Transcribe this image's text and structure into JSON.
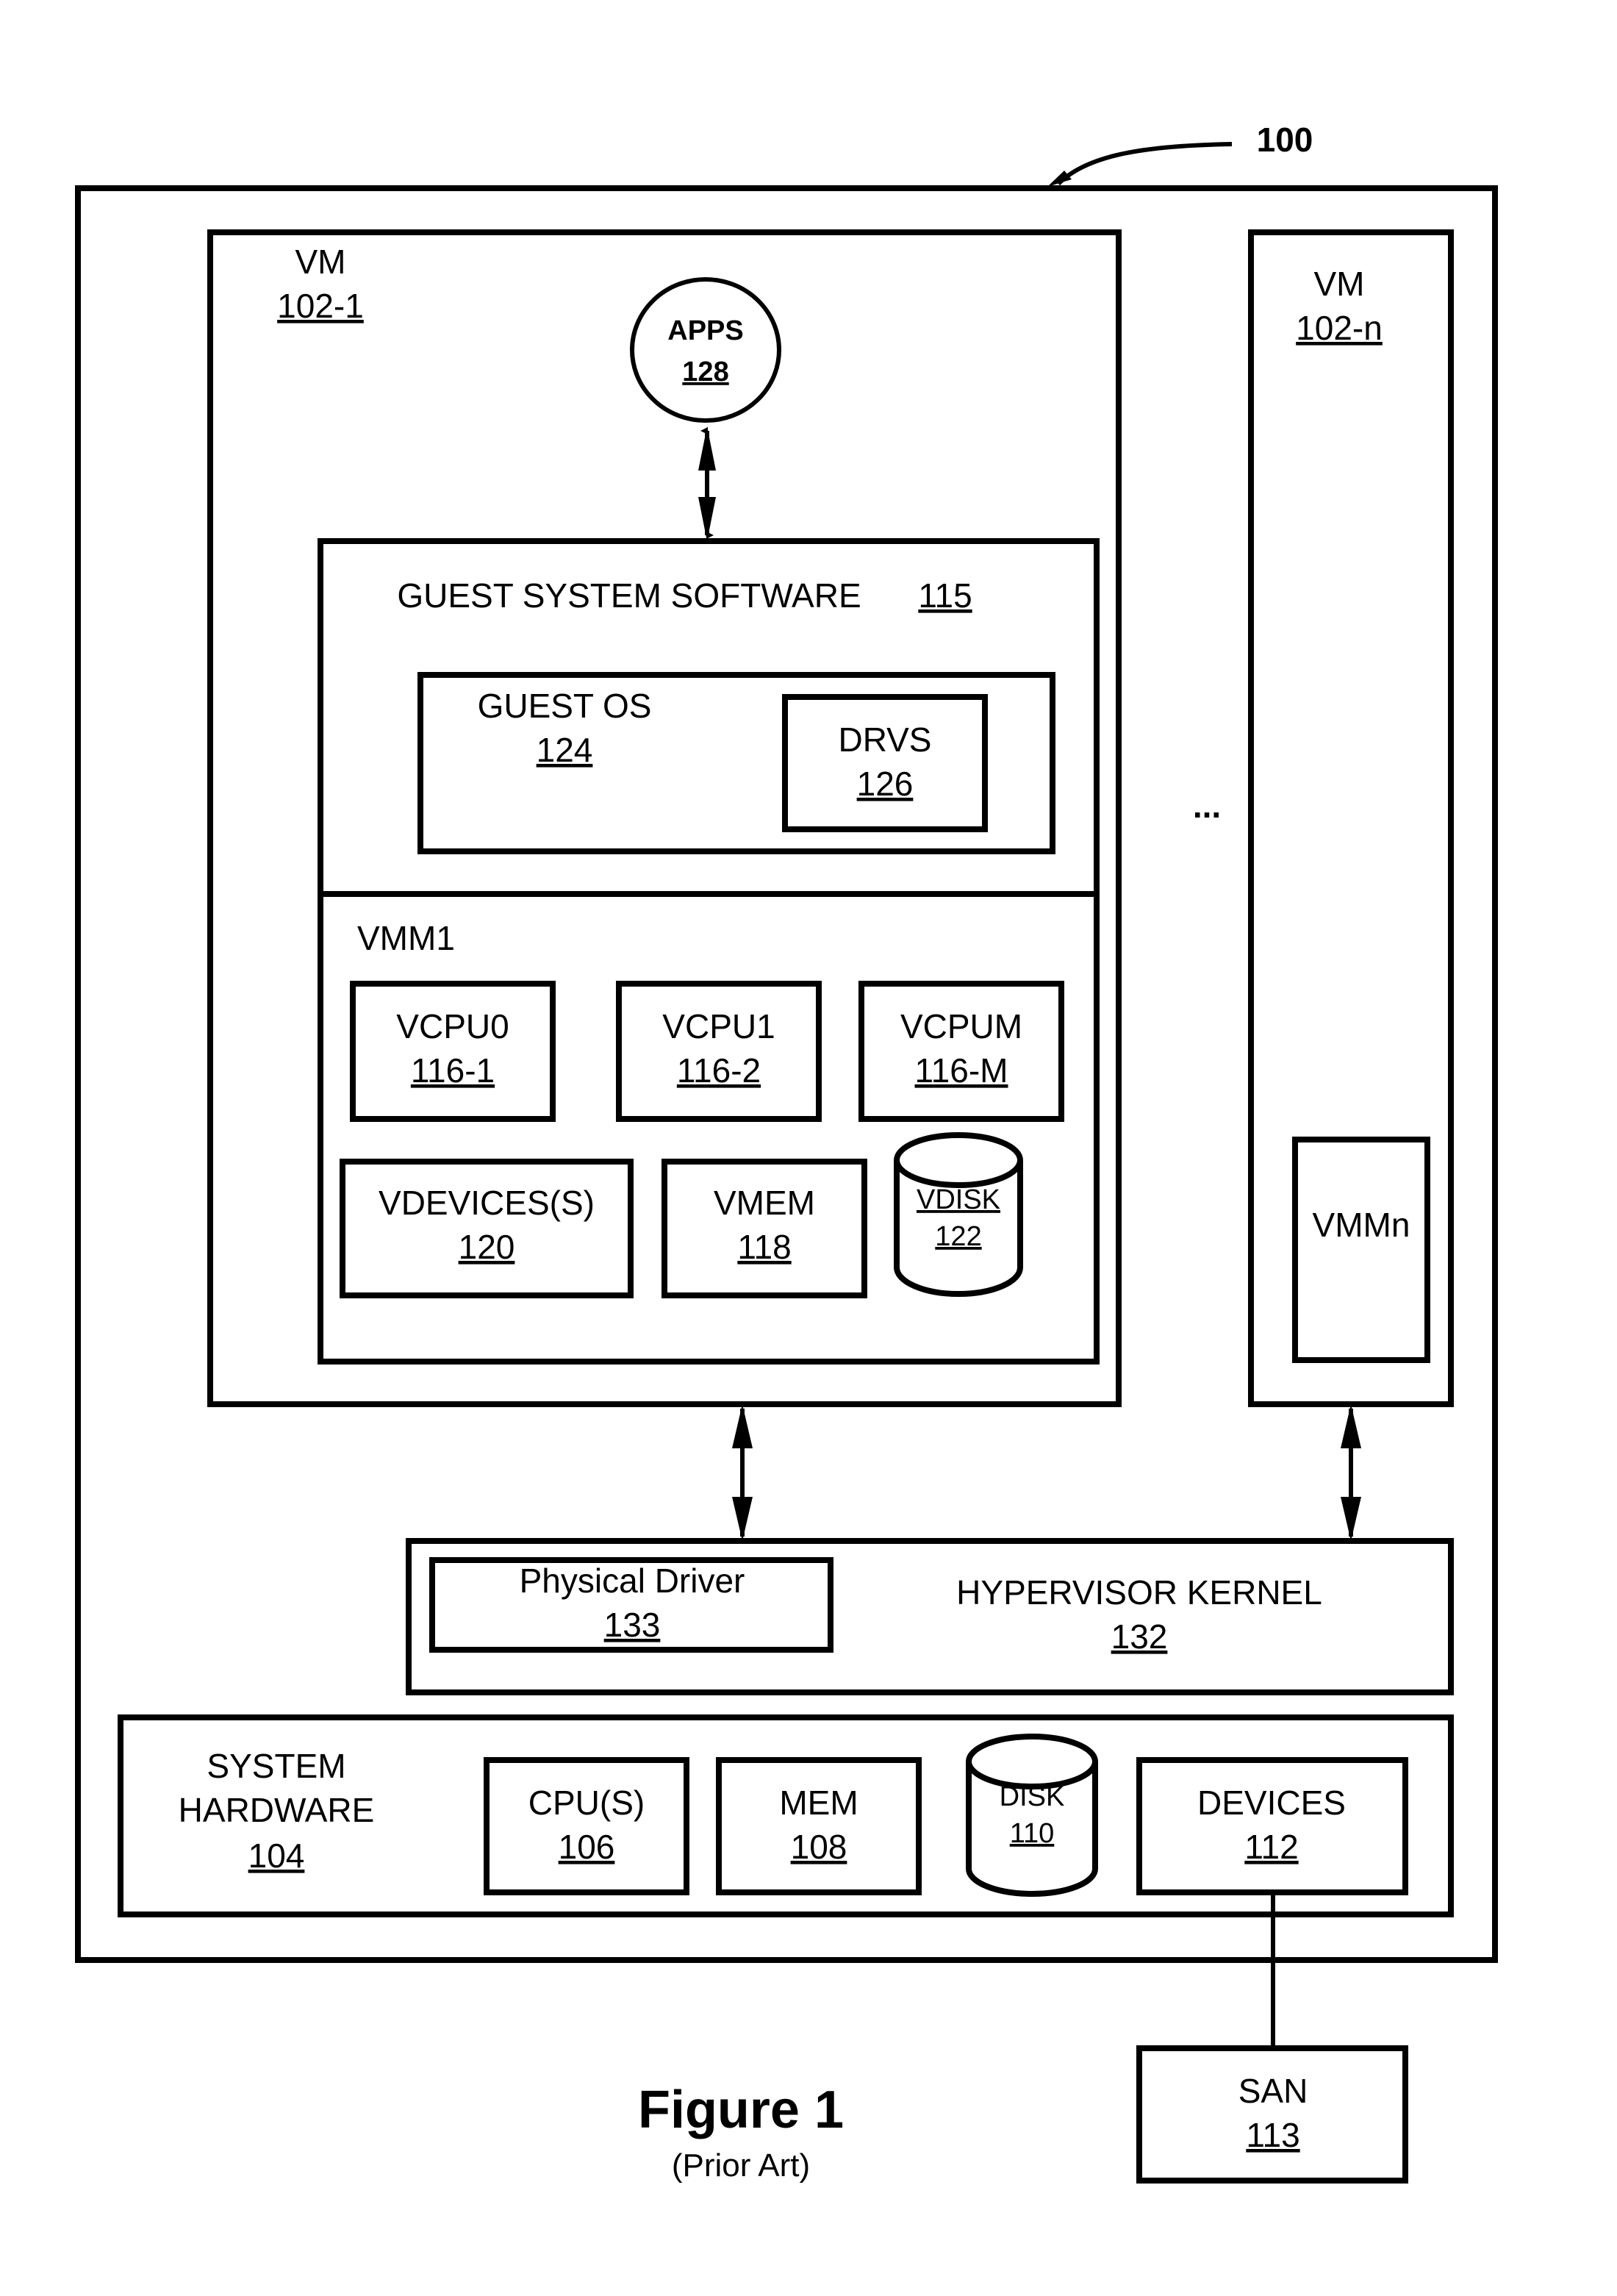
{
  "figure": {
    "ref_label": "100",
    "title": "Figure 1",
    "subtitle": "(Prior Art)"
  },
  "vm1": {
    "label": "VM",
    "ref": "102-1",
    "apps": {
      "label": "APPS",
      "ref": "128"
    },
    "guest_system_software": {
      "label": "GUEST SYSTEM SOFTWARE",
      "ref": "115"
    },
    "guest_os": {
      "label": "GUEST OS",
      "ref": "124"
    },
    "drvs": {
      "label": "DRVS",
      "ref": "126"
    },
    "vmm": {
      "label": "VMM1",
      "vcpus": [
        {
          "label": "VCPU0",
          "ref": "116-1"
        },
        {
          "label": "VCPU1",
          "ref": "116-2"
        },
        {
          "label": "VCPUM",
          "ref": "116-M"
        }
      ],
      "vdevices": {
        "label": "VDEVICES(S)",
        "ref": "120"
      },
      "vmem": {
        "label": "VMEM",
        "ref": "118"
      },
      "vdisk": {
        "label": "VDISK",
        "ref": "122"
      }
    }
  },
  "ellipsis": "...",
  "vmn": {
    "label": "VM",
    "ref": "102-n",
    "vmm_label": "VMMn"
  },
  "hypervisor": {
    "label": "HYPERVISOR KERNEL",
    "ref": "132",
    "physical_driver": {
      "label": "Physical Driver",
      "ref": "133"
    }
  },
  "hardware": {
    "label_line1": "SYSTEM",
    "label_line2": "HARDWARE",
    "ref": "104",
    "cpu": {
      "label": "CPU(S)",
      "ref": "106"
    },
    "mem": {
      "label": "MEM",
      "ref": "108"
    },
    "disk": {
      "label": "DISK",
      "ref": "110"
    },
    "devices": {
      "label": "DEVICES",
      "ref": "112"
    }
  },
  "san": {
    "label": "SAN",
    "ref": "113"
  }
}
